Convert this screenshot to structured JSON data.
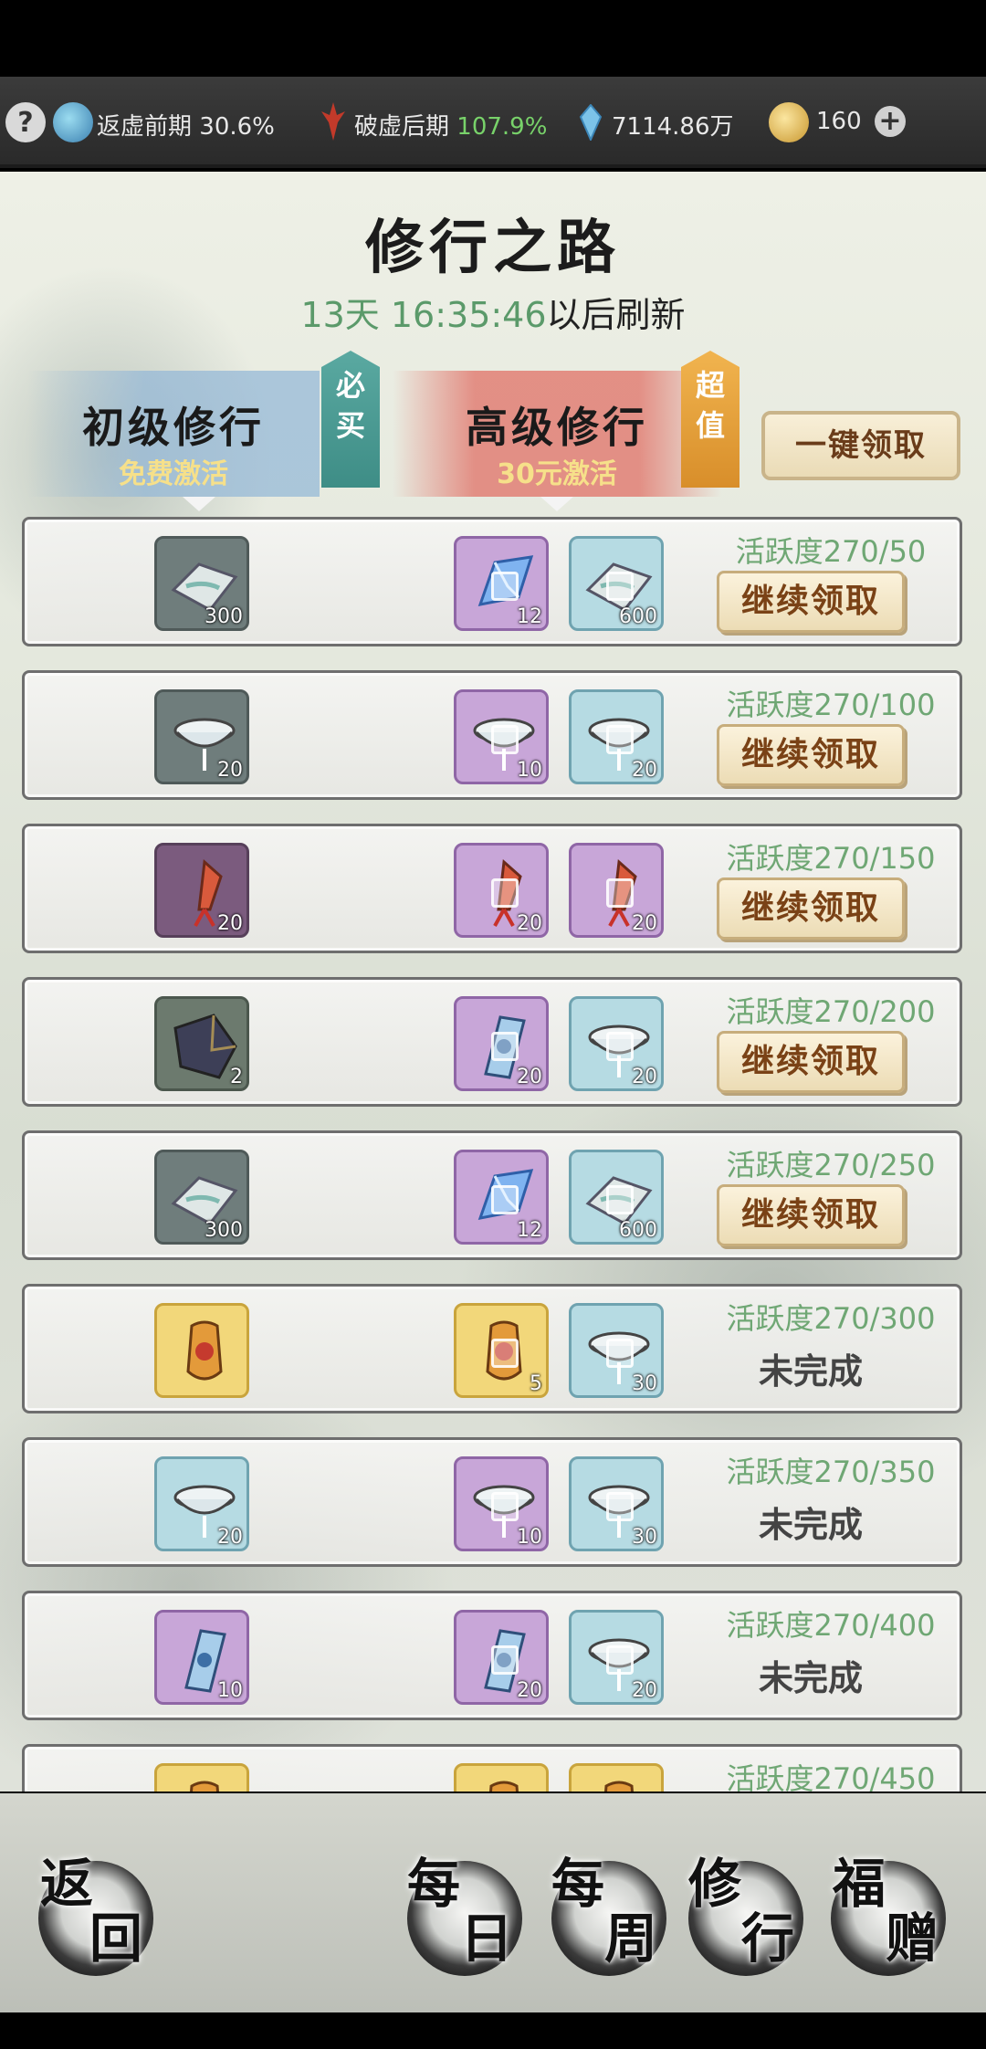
{
  "topbar": {
    "realm1_label": "返虚前期",
    "realm1_pct": "30.6%",
    "realm2_label": "破虚后期",
    "realm2_pct": "107.9%",
    "spirit_stones": "7114.86万",
    "gold": "160",
    "help_glyph": "?",
    "plus_glyph": "+",
    "icons": [
      "help-icon",
      "yinyang-icon",
      "flame-flower-icon",
      "crystal-icon",
      "gold-coin-icon",
      "plus-icon"
    ]
  },
  "header": {
    "title": "修行之路",
    "refresh_time": "13天 16:35:46",
    "refresh_suffix": "以后刷新"
  },
  "tiers": {
    "basic": {
      "name": "初级修行",
      "sub": "免费激活",
      "badge": [
        "必",
        "买"
      ]
    },
    "premium": {
      "name": "高级修行",
      "sub": "30元激活",
      "badge": [
        "超",
        "值"
      ]
    },
    "claim_all": "一键领取"
  },
  "rows": [
    {
      "basic": {
        "item": "cloth",
        "color": "gray",
        "count": "300"
      },
      "adv1": {
        "item": "crystal",
        "color": "purple",
        "count": "12"
      },
      "adv2": {
        "item": "cloth",
        "color": "blue",
        "count": "600"
      },
      "activity": "活跃度270/50",
      "status": "继续领取"
    },
    {
      "basic": {
        "item": "bowl",
        "color": "gray",
        "count": "20"
      },
      "adv1": {
        "item": "bowl",
        "color": "purple",
        "count": "10"
      },
      "adv2": {
        "item": "bowl",
        "color": "blue",
        "count": "20"
      },
      "activity": "活跃度270/100",
      "status": "继续领取"
    },
    {
      "basic": {
        "item": "tassel",
        "color": "dpurple",
        "count": "20"
      },
      "adv1": {
        "item": "tassel",
        "color": "purple",
        "count": "20"
      },
      "adv2": {
        "item": "tassel",
        "color": "purple",
        "count": "20"
      },
      "activity": "活跃度270/150",
      "status": "继续领取"
    },
    {
      "basic": {
        "item": "stone",
        "color": "green",
        "count": "2"
      },
      "adv1": {
        "item": "talisman",
        "color": "purple",
        "count": "20"
      },
      "adv2": {
        "item": "bowl",
        "color": "blue",
        "count": "20"
      },
      "activity": "活跃度270/200",
      "status": "继续领取"
    },
    {
      "basic": {
        "item": "cloth",
        "color": "gray",
        "count": "300"
      },
      "adv1": {
        "item": "crystal",
        "color": "purple",
        "count": "12"
      },
      "adv2": {
        "item": "cloth",
        "color": "blue",
        "count": "600"
      },
      "activity": "活跃度270/250",
      "status": "继续领取"
    },
    {
      "basic": {
        "item": "amulet",
        "color": "gold",
        "count": ""
      },
      "adv1": {
        "item": "amulet",
        "color": "gold",
        "count": "5"
      },
      "adv2": {
        "item": "bowl",
        "color": "blue",
        "count": "30"
      },
      "activity": "活跃度270/300",
      "status": "未完成"
    },
    {
      "basic": {
        "item": "bowl",
        "color": "blue",
        "count": "20"
      },
      "adv1": {
        "item": "bowl",
        "color": "purple",
        "count": "10"
      },
      "adv2": {
        "item": "bowl",
        "color": "blue",
        "count": "30"
      },
      "activity": "活跃度270/350",
      "status": "未完成"
    },
    {
      "basic": {
        "item": "talisman",
        "color": "purple",
        "count": "10"
      },
      "adv1": {
        "item": "talisman",
        "color": "purple",
        "count": "20"
      },
      "adv2": {
        "item": "bowl",
        "color": "blue",
        "count": "20"
      },
      "activity": "活跃度270/400",
      "status": "未完成"
    },
    {
      "basic": {
        "item": "amulet",
        "color": "gold",
        "count": ""
      },
      "adv1": {
        "item": "amulet",
        "color": "gold",
        "count": ""
      },
      "adv2": {
        "item": "amulet",
        "color": "gold",
        "count": ""
      },
      "activity": "活跃度270/450",
      "status": ""
    }
  ],
  "bottom_nav": {
    "back": [
      "返",
      "回"
    ],
    "daily": [
      "每",
      "日"
    ],
    "weekly": [
      "每",
      "周"
    ],
    "cultivation": [
      "修",
      "行"
    ],
    "gift": [
      "福",
      "赠"
    ]
  },
  "colors": {
    "activity_green": "#6fa774",
    "realm_green": "#78d26a",
    "premium_red": "#e1786e",
    "basic_blue": "#96b9d7",
    "button_text": "#7a4216"
  }
}
